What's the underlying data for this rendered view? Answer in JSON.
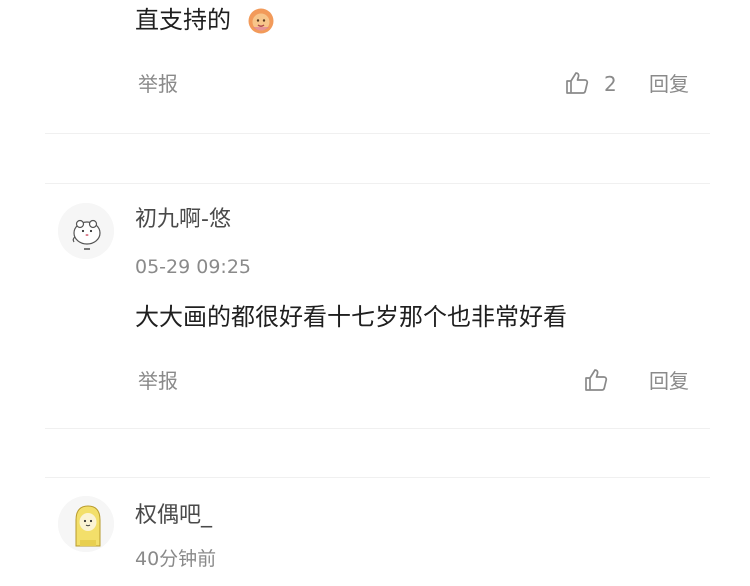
{
  "comments": [
    {
      "text": "直支持的",
      "emoji_icon": "lion-face-emoji",
      "report_label": "举报",
      "like_count": "2",
      "reply_label": "回复"
    },
    {
      "author": "初九啊-悠",
      "avatar_icon": "hamster-avatar",
      "time": "05-29 09:25",
      "text": "大大画的都很好看十七岁那个也非常好看",
      "report_label": "举报",
      "reply_label": "回复"
    },
    {
      "author": "权偶吧_",
      "avatar_icon": "yellow-hood-character-avatar",
      "time": "40分钟前"
    }
  ],
  "colors": {
    "secondary_text": "#8a8a8a",
    "primary_text": "#1f1f1f",
    "divider": "#f0f0f0"
  }
}
